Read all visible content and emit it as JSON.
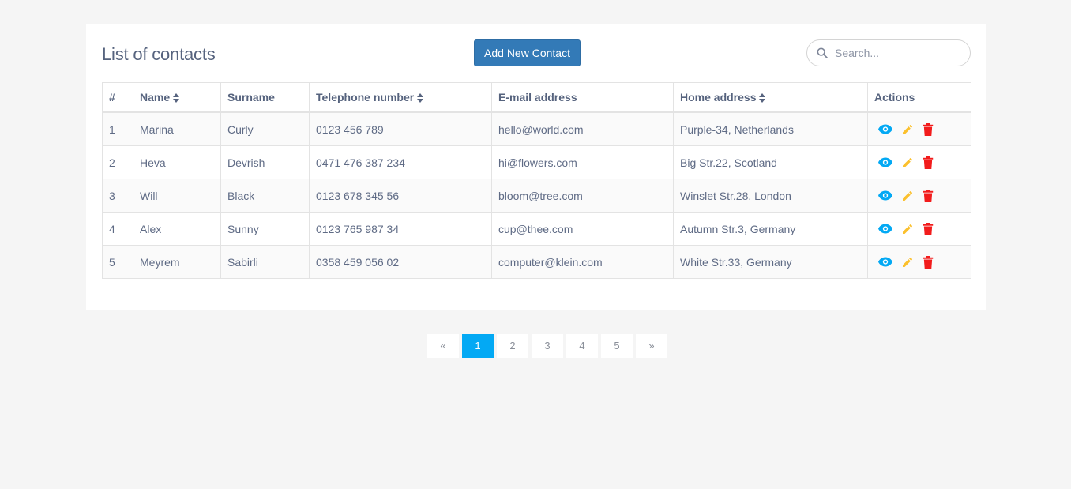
{
  "header": {
    "title": "List of contacts",
    "add_button_label": "Add New Contact",
    "search_placeholder": "Search..."
  },
  "table": {
    "columns": [
      {
        "label": "#",
        "sortable": false
      },
      {
        "label": "Name",
        "sortable": true
      },
      {
        "label": "Surname",
        "sortable": false
      },
      {
        "label": "Telephone number",
        "sortable": true
      },
      {
        "label": "E-mail address",
        "sortable": false
      },
      {
        "label": "Home address",
        "sortable": true
      },
      {
        "label": "Actions",
        "sortable": false
      }
    ],
    "rows": [
      {
        "num": "1",
        "name": "Marina",
        "surname": "Curly",
        "phone": "0123 456 789",
        "email": "hello@world.com",
        "address": "Purple-34, Netherlands"
      },
      {
        "num": "2",
        "name": "Heva",
        "surname": "Devrish",
        "phone": "0471 476 387 234",
        "email": "hi@flowers.com",
        "address": "Big Str.22, Scotland"
      },
      {
        "num": "3",
        "name": "Will",
        "surname": "Black",
        "phone": "0123 678 345 56",
        "email": "bloom@tree.com",
        "address": "Winslet Str.28, London"
      },
      {
        "num": "4",
        "name": "Alex",
        "surname": "Sunny",
        "phone": "0123 765 987 34",
        "email": "cup@thee.com",
        "address": "Autumn Str.3, Germany"
      },
      {
        "num": "5",
        "name": "Meyrem",
        "surname": "Sabirli",
        "phone": "0358 459 056 02",
        "email": "computer@klein.com",
        "address": "White Str.33, Germany"
      }
    ],
    "row_actions": [
      {
        "icon": "eye-icon",
        "color": "#03a9f4"
      },
      {
        "icon": "pencil-icon",
        "color": "#fbc02d"
      },
      {
        "icon": "trash-icon",
        "color": "#f21c1c"
      }
    ]
  },
  "pagination": {
    "prev": "«",
    "next": "»",
    "pages": [
      "1",
      "2",
      "3",
      "4",
      "5"
    ],
    "current": "1"
  },
  "colors": {
    "primary_button": "#337ab7",
    "accent": "#03a9f4",
    "background": "#f5f5f5"
  }
}
